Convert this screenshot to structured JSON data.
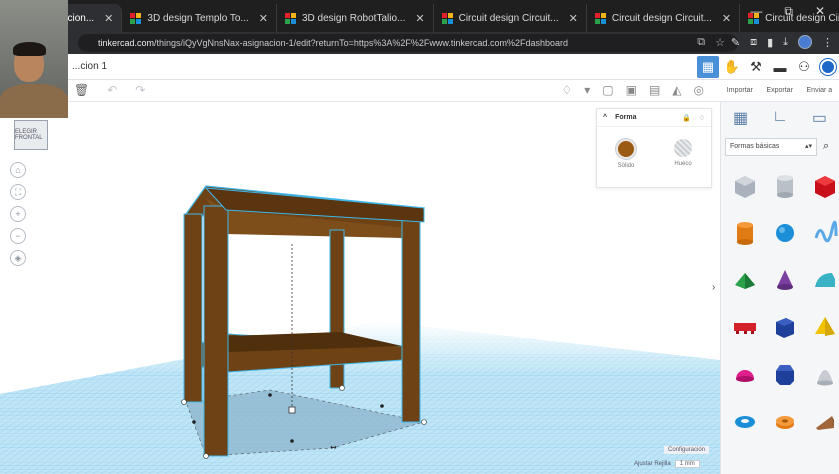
{
  "browser": {
    "tabs": [
      {
        "label": "...sign Asignacion...",
        "active": true
      },
      {
        "label": "3D design Templo To..."
      },
      {
        "label": "3D design RobotTalio..."
      },
      {
        "label": "Circuit design Circuit..."
      },
      {
        "label": "Circuit design Circuit..."
      },
      {
        "label": "Circuit design Circuit..."
      }
    ],
    "new_tab": "+",
    "window_controls": [
      "—",
      "⧉",
      "✕"
    ],
    "url_domain": "tinkercad.com",
    "url_path": "/things/iQyVgNnsNax-asignacion-1/edit?returnTo=https%3A%2F%2Fwww.tinkercad.com%2Fdashboard"
  },
  "app": {
    "title": "...cion 1",
    "header_actions": [
      "Importar",
      "Exportar",
      "Enviar a"
    ]
  },
  "shape_panel": {
    "title": "Forma",
    "solid_label": "Sólido",
    "hole_label": "Hueco",
    "solid_color": "#9a5a12"
  },
  "workplane": {
    "settings_label": "Configuración",
    "snap_label": "Ajustar Rejilla",
    "snap_value": "1 mm",
    "view_cube_label": "ELEGIR FRONTAL"
  },
  "library": {
    "category": "Formas básicas",
    "shapes": [
      {
        "name": "box-striped",
        "color": "#aab3bd"
      },
      {
        "name": "cylinder-striped",
        "color": "#b9c0c8"
      },
      {
        "name": "box",
        "color": "#e0202a"
      },
      {
        "name": "cylinder",
        "color": "#e07a12"
      },
      {
        "name": "sphere",
        "color": "#1a8fd8"
      },
      {
        "name": "scribble",
        "color": "#5aa9e6"
      },
      {
        "name": "roof",
        "color": "#2aa14a"
      },
      {
        "name": "cone",
        "color": "#7b3fa0"
      },
      {
        "name": "round-roof",
        "color": "#38b2c4"
      },
      {
        "name": "text",
        "color": "#d4202a"
      },
      {
        "name": "cube-blue",
        "color": "#1e3f9a"
      },
      {
        "name": "pyramid",
        "color": "#f2c200"
      },
      {
        "name": "half-sphere",
        "color": "#e0208a"
      },
      {
        "name": "polygon",
        "color": "#1e3f9a"
      },
      {
        "name": "paraboloid",
        "color": "#c8ccd2"
      },
      {
        "name": "torus",
        "color": "#1a8fd8"
      },
      {
        "name": "tube",
        "color": "#e07a12"
      },
      {
        "name": "wedge",
        "color": "#a0663a"
      }
    ]
  },
  "colors": {
    "accent": "#4a90d9",
    "grid": "#6fc3ea",
    "model": "#6e4215",
    "selection": "#3fb7ea"
  }
}
